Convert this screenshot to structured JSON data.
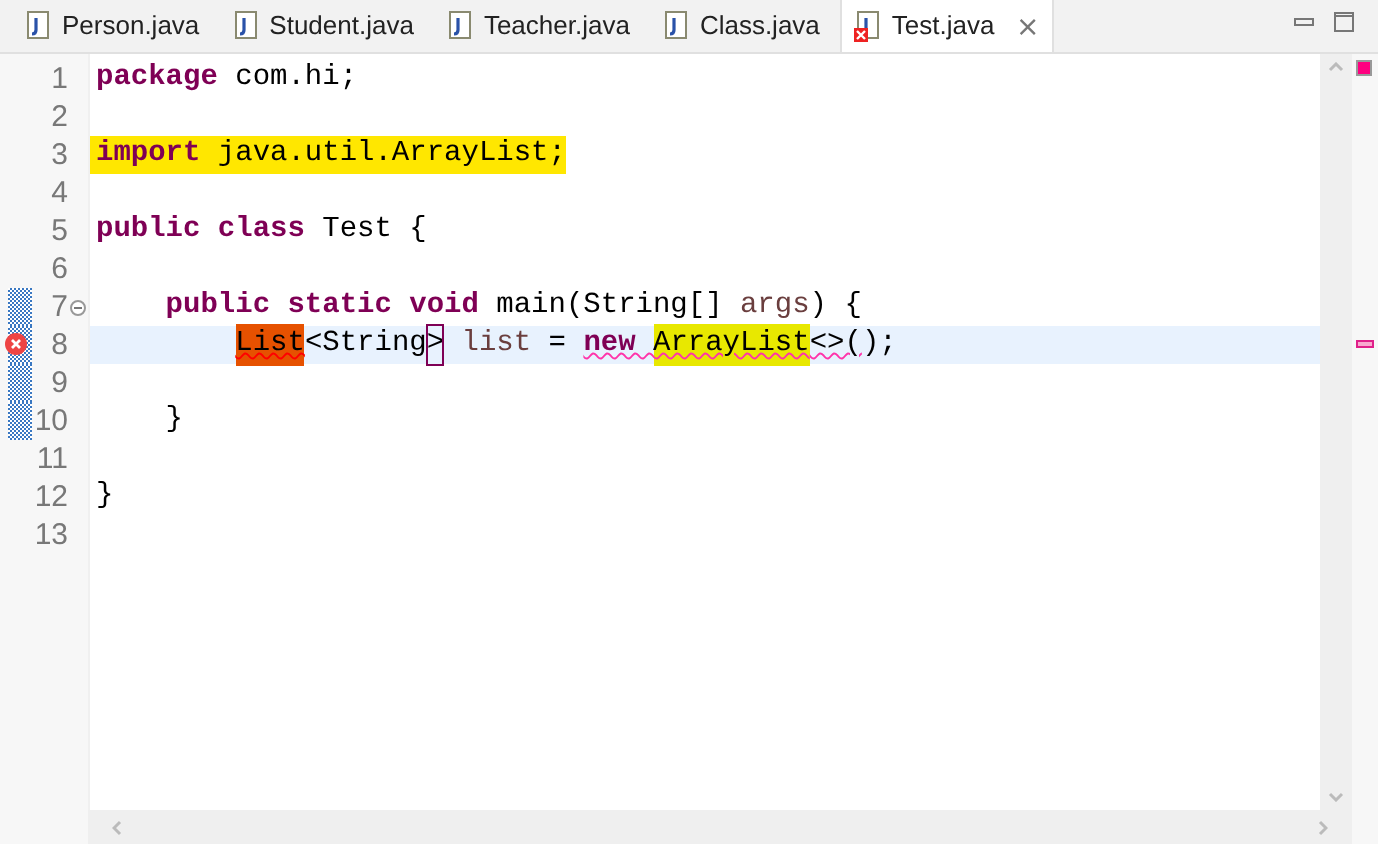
{
  "tabs": [
    {
      "label": "Person.java",
      "selected": false,
      "error": false
    },
    {
      "label": "Student.java",
      "selected": false,
      "error": false
    },
    {
      "label": "Teacher.java",
      "selected": false,
      "error": false
    },
    {
      "label": "Class.java",
      "selected": false,
      "error": false
    },
    {
      "label": "Test.java",
      "selected": true,
      "error": true
    }
  ],
  "close_glyph": "⨯",
  "lines": [
    {
      "number": "1",
      "tokens": [
        {
          "kind": "keyword",
          "text": "package"
        },
        {
          "kind": "text",
          "text": " com.hi;"
        }
      ]
    },
    {
      "number": "2"
    },
    {
      "number": "3",
      "marked": true,
      "tokens": [
        {
          "kind": "keyword",
          "text": "import"
        },
        {
          "kind": "text",
          "text": " java.util.ArrayList;"
        }
      ]
    },
    {
      "number": "4"
    },
    {
      "number": "5",
      "tokens": [
        {
          "kind": "keyword",
          "text": "public "
        },
        {
          "kind": "keyword",
          "text": "class"
        },
        {
          "kind": "text",
          "text": " Test {"
        }
      ]
    },
    {
      "number": "6"
    },
    {
      "number": "7",
      "foldable": true,
      "range": true,
      "tokens": [
        {
          "kind": "keyword",
          "text": "    public "
        },
        {
          "kind": "keyword",
          "text": "static "
        },
        {
          "kind": "keyword",
          "text": "void"
        },
        {
          "kind": "text",
          "text": " main(String[] "
        },
        {
          "kind": "variable",
          "text": "args"
        },
        {
          "kind": "text",
          "text": ") {"
        }
      ]
    },
    {
      "number": "8",
      "current": true,
      "error": true,
      "range": true,
      "tokens": [
        {
          "kind": "text",
          "text": "        List",
          "error_mark": true,
          "error_underline": true
        },
        {
          "kind": "text",
          "text": "<String"
        },
        {
          "kind": "text",
          "text": ">",
          "matching_bracket": true
        },
        {
          "kind": "variable",
          "text": " list"
        },
        {
          "kind": "text",
          "text": " = "
        },
        {
          "kind": "keyword",
          "text": "new ",
          "warning_underline": true
        },
        {
          "kind": "text",
          "text": "ArrayList",
          "occurrence": true,
          "warning_underline": true
        },
        {
          "kind": "text",
          "text": "<>(",
          "warning_underline": true
        },
        {
          "kind": "text",
          "text": ");"
        }
      ]
    },
    {
      "number": "9",
      "range": true
    },
    {
      "number": "10",
      "range": true,
      "tokens": [
        {
          "kind": "text",
          "text": "    }"
        }
      ]
    },
    {
      "number": "11"
    },
    {
      "number": "12",
      "tokens": [
        {
          "kind": "text",
          "text": "}"
        }
      ]
    },
    {
      "number": "13"
    }
  ]
}
